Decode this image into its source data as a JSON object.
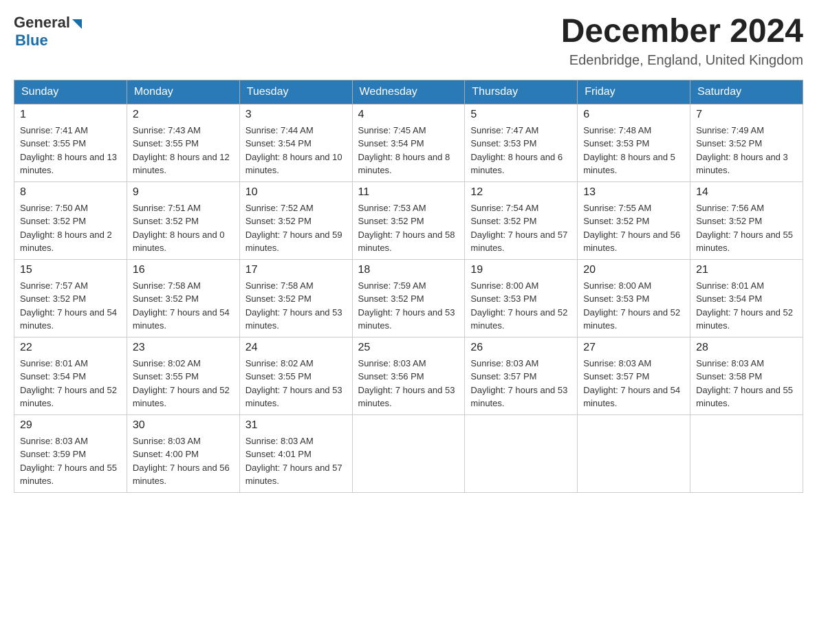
{
  "logo": {
    "general": "General",
    "blue": "Blue"
  },
  "title": "December 2024",
  "location": "Edenbridge, England, United Kingdom",
  "days_of_week": [
    "Sunday",
    "Monday",
    "Tuesday",
    "Wednesday",
    "Thursday",
    "Friday",
    "Saturday"
  ],
  "weeks": [
    [
      {
        "day": "1",
        "sunrise": "7:41 AM",
        "sunset": "3:55 PM",
        "daylight": "8 hours and 13 minutes."
      },
      {
        "day": "2",
        "sunrise": "7:43 AM",
        "sunset": "3:55 PM",
        "daylight": "8 hours and 12 minutes."
      },
      {
        "day": "3",
        "sunrise": "7:44 AM",
        "sunset": "3:54 PM",
        "daylight": "8 hours and 10 minutes."
      },
      {
        "day": "4",
        "sunrise": "7:45 AM",
        "sunset": "3:54 PM",
        "daylight": "8 hours and 8 minutes."
      },
      {
        "day": "5",
        "sunrise": "7:47 AM",
        "sunset": "3:53 PM",
        "daylight": "8 hours and 6 minutes."
      },
      {
        "day": "6",
        "sunrise": "7:48 AM",
        "sunset": "3:53 PM",
        "daylight": "8 hours and 5 minutes."
      },
      {
        "day": "7",
        "sunrise": "7:49 AM",
        "sunset": "3:52 PM",
        "daylight": "8 hours and 3 minutes."
      }
    ],
    [
      {
        "day": "8",
        "sunrise": "7:50 AM",
        "sunset": "3:52 PM",
        "daylight": "8 hours and 2 minutes."
      },
      {
        "day": "9",
        "sunrise": "7:51 AM",
        "sunset": "3:52 PM",
        "daylight": "8 hours and 0 minutes."
      },
      {
        "day": "10",
        "sunrise": "7:52 AM",
        "sunset": "3:52 PM",
        "daylight": "7 hours and 59 minutes."
      },
      {
        "day": "11",
        "sunrise": "7:53 AM",
        "sunset": "3:52 PM",
        "daylight": "7 hours and 58 minutes."
      },
      {
        "day": "12",
        "sunrise": "7:54 AM",
        "sunset": "3:52 PM",
        "daylight": "7 hours and 57 minutes."
      },
      {
        "day": "13",
        "sunrise": "7:55 AM",
        "sunset": "3:52 PM",
        "daylight": "7 hours and 56 minutes."
      },
      {
        "day": "14",
        "sunrise": "7:56 AM",
        "sunset": "3:52 PM",
        "daylight": "7 hours and 55 minutes."
      }
    ],
    [
      {
        "day": "15",
        "sunrise": "7:57 AM",
        "sunset": "3:52 PM",
        "daylight": "7 hours and 54 minutes."
      },
      {
        "day": "16",
        "sunrise": "7:58 AM",
        "sunset": "3:52 PM",
        "daylight": "7 hours and 54 minutes."
      },
      {
        "day": "17",
        "sunrise": "7:58 AM",
        "sunset": "3:52 PM",
        "daylight": "7 hours and 53 minutes."
      },
      {
        "day": "18",
        "sunrise": "7:59 AM",
        "sunset": "3:52 PM",
        "daylight": "7 hours and 53 minutes."
      },
      {
        "day": "19",
        "sunrise": "8:00 AM",
        "sunset": "3:53 PM",
        "daylight": "7 hours and 52 minutes."
      },
      {
        "day": "20",
        "sunrise": "8:00 AM",
        "sunset": "3:53 PM",
        "daylight": "7 hours and 52 minutes."
      },
      {
        "day": "21",
        "sunrise": "8:01 AM",
        "sunset": "3:54 PM",
        "daylight": "7 hours and 52 minutes."
      }
    ],
    [
      {
        "day": "22",
        "sunrise": "8:01 AM",
        "sunset": "3:54 PM",
        "daylight": "7 hours and 52 minutes."
      },
      {
        "day": "23",
        "sunrise": "8:02 AM",
        "sunset": "3:55 PM",
        "daylight": "7 hours and 52 minutes."
      },
      {
        "day": "24",
        "sunrise": "8:02 AM",
        "sunset": "3:55 PM",
        "daylight": "7 hours and 53 minutes."
      },
      {
        "day": "25",
        "sunrise": "8:03 AM",
        "sunset": "3:56 PM",
        "daylight": "7 hours and 53 minutes."
      },
      {
        "day": "26",
        "sunrise": "8:03 AM",
        "sunset": "3:57 PM",
        "daylight": "7 hours and 53 minutes."
      },
      {
        "day": "27",
        "sunrise": "8:03 AM",
        "sunset": "3:57 PM",
        "daylight": "7 hours and 54 minutes."
      },
      {
        "day": "28",
        "sunrise": "8:03 AM",
        "sunset": "3:58 PM",
        "daylight": "7 hours and 55 minutes."
      }
    ],
    [
      {
        "day": "29",
        "sunrise": "8:03 AM",
        "sunset": "3:59 PM",
        "daylight": "7 hours and 55 minutes."
      },
      {
        "day": "30",
        "sunrise": "8:03 AM",
        "sunset": "4:00 PM",
        "daylight": "7 hours and 56 minutes."
      },
      {
        "day": "31",
        "sunrise": "8:03 AM",
        "sunset": "4:01 PM",
        "daylight": "7 hours and 57 minutes."
      },
      null,
      null,
      null,
      null
    ]
  ]
}
